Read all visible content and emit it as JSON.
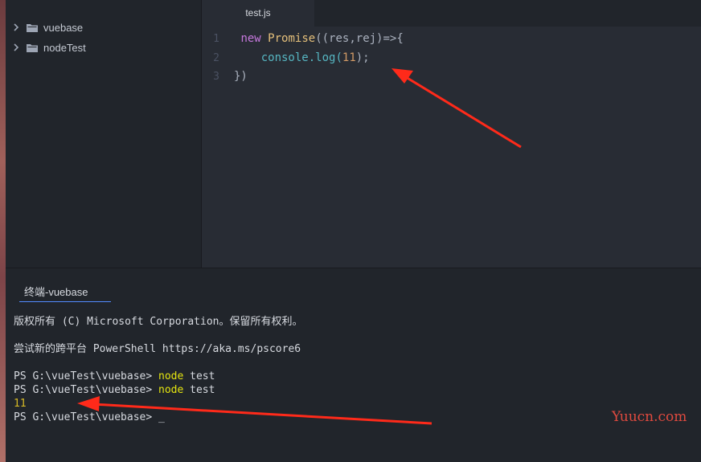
{
  "sidebar": {
    "items": [
      {
        "label": "vuebase",
        "icon": "folder-icon"
      },
      {
        "label": "nodeTest",
        "icon": "folder-icon"
      }
    ]
  },
  "editor": {
    "tab_label": "test.js",
    "line_numbers": [
      "1",
      "2",
      "3"
    ],
    "line1": {
      "kw": "new",
      "cls": "Promise",
      "rest": "((res,rej)=>{"
    },
    "line2": {
      "obj": "console",
      "dot_log": ".log(",
      "num": "11",
      "end": ");"
    },
    "line3": "})"
  },
  "terminal": {
    "tab_label": "终端-vuebase",
    "lines": {
      "copyright": "版权所有 (C) Microsoft Corporation。保留所有权利。",
      "tryps": "尝试新的跨平台 PowerShell https://aka.ms/pscore6",
      "prompt1": "PS G:\\vueTest\\vuebase> ",
      "cmd1_node": "node",
      "cmd1_arg": " test",
      "prompt2": "PS G:\\vueTest\\vuebase> ",
      "cmd2_node": "node",
      "cmd2_arg": " test",
      "output": "11",
      "prompt3": "PS G:\\vueTest\\vuebase> ",
      "cursor": "_"
    }
  },
  "watermark": "Yuucn.com",
  "colors": {
    "arrow": "#ff2a1a",
    "accent": "#528bff"
  }
}
